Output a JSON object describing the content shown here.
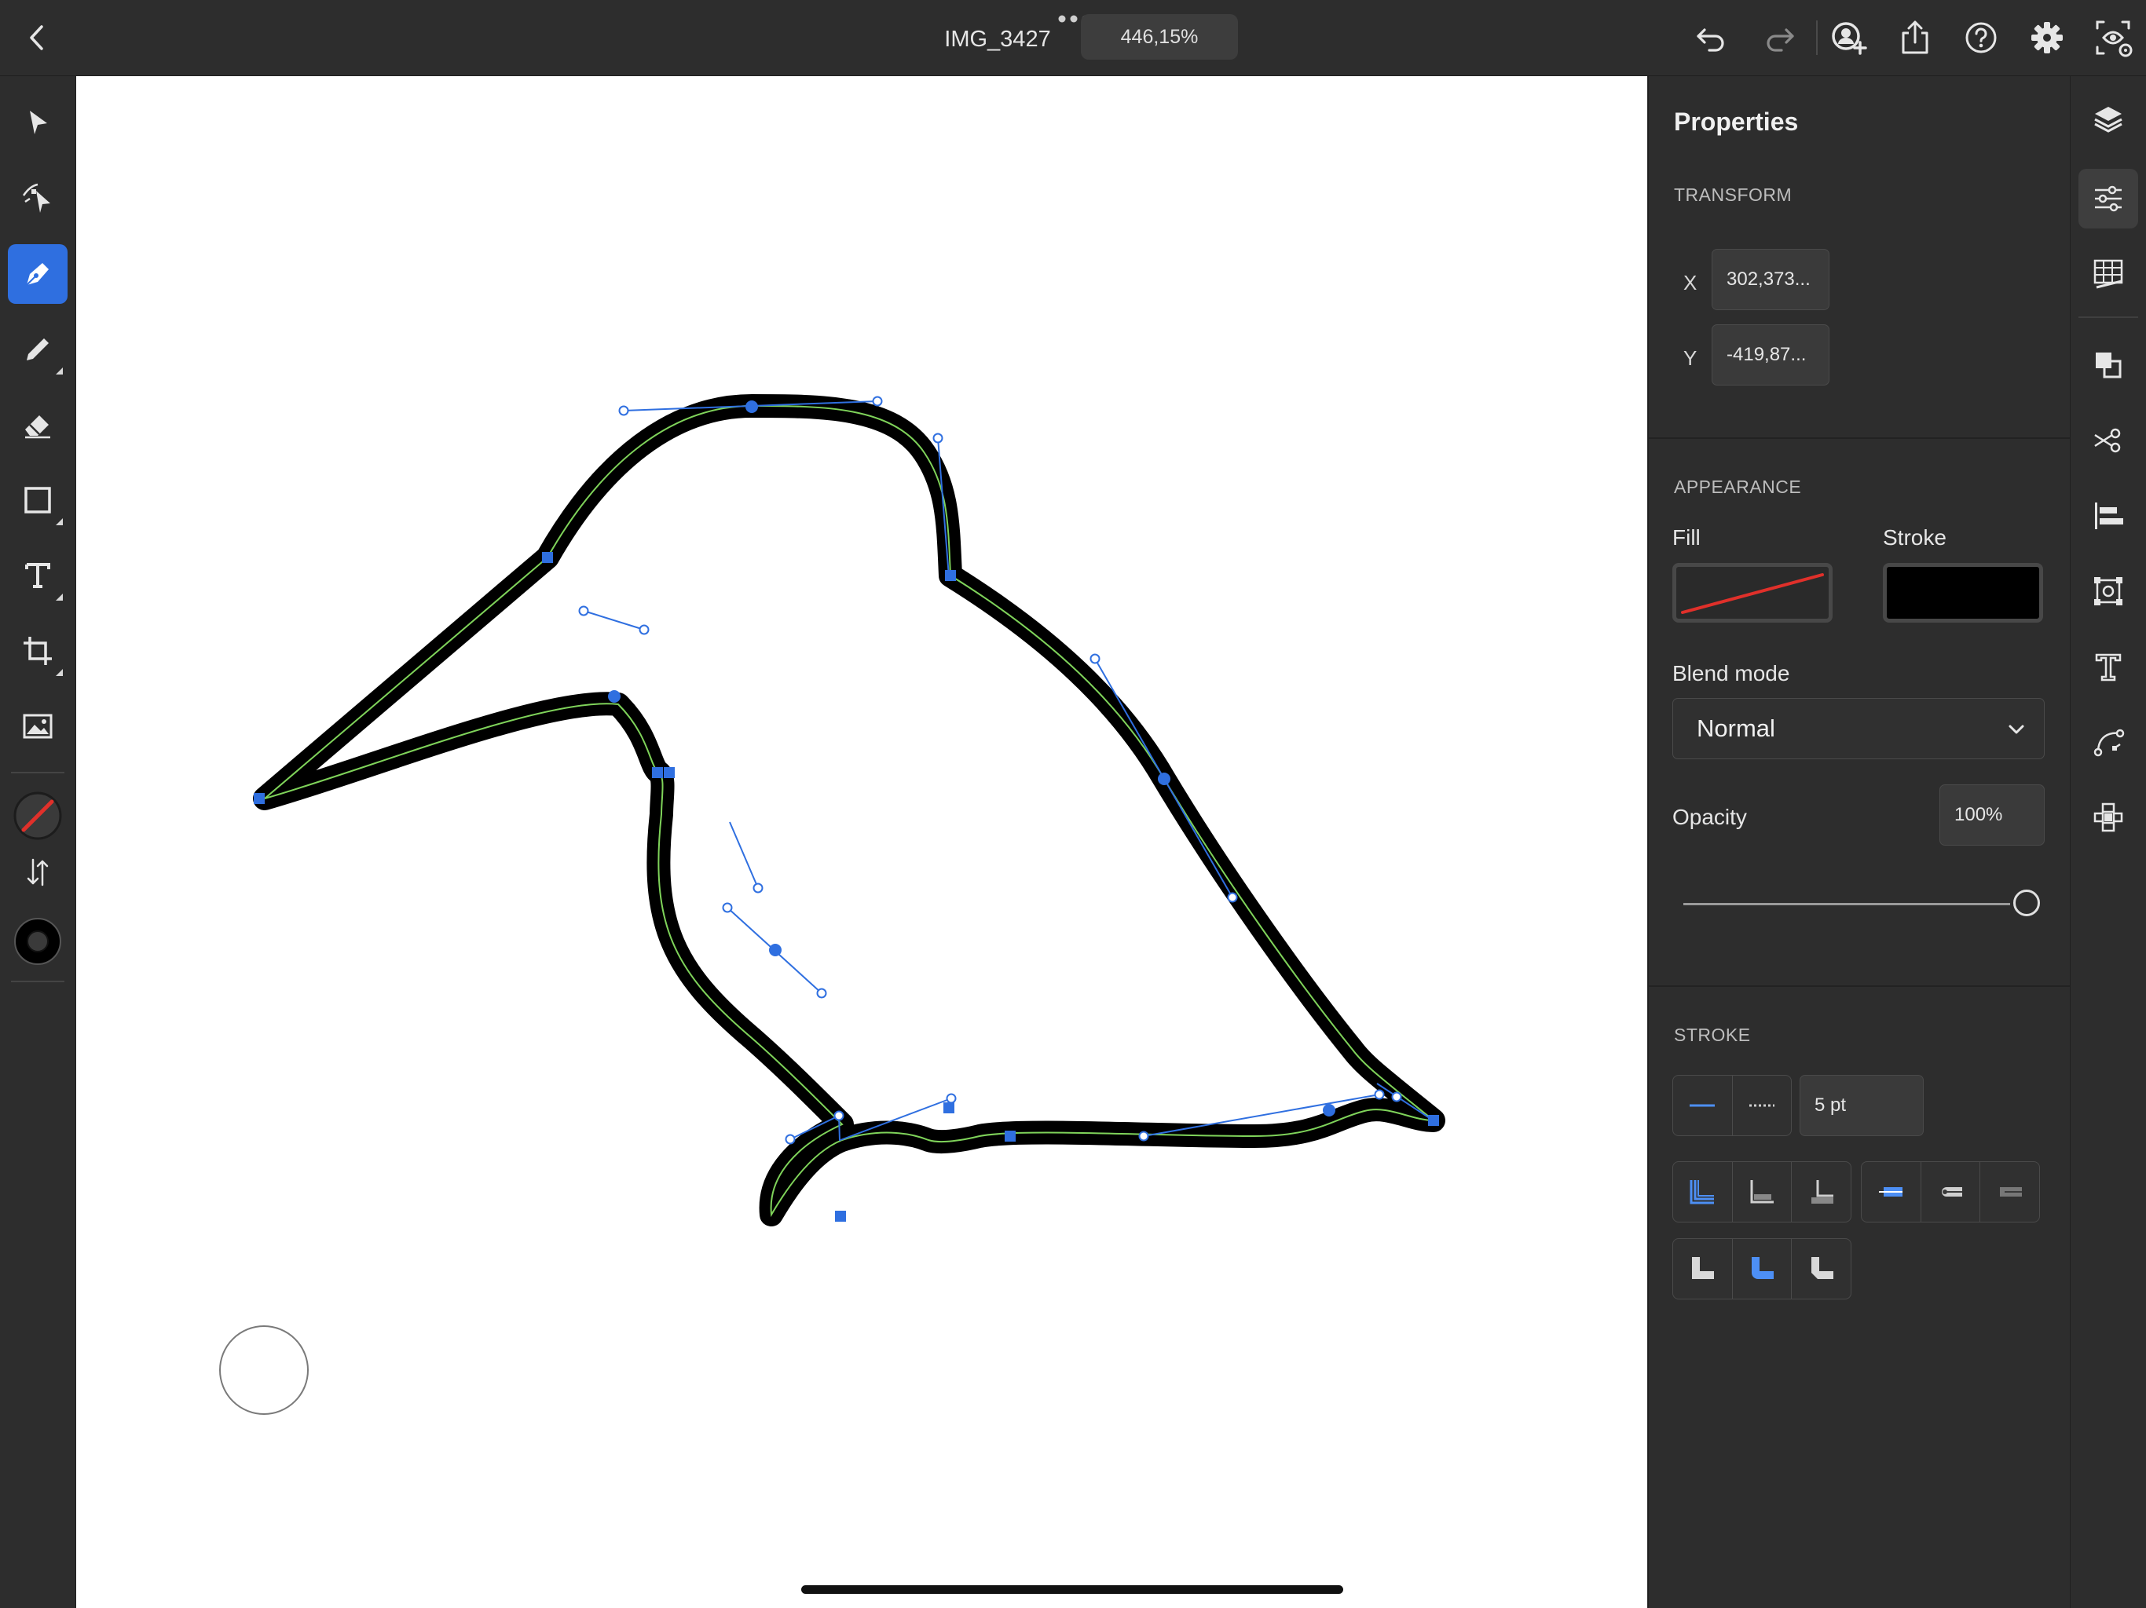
{
  "document": {
    "title": "IMG_3427",
    "zoom": "446,15%"
  },
  "toolbar": {
    "tools": [
      "selection-tool",
      "direct-selection-tool",
      "pen-tool",
      "pencil-tool",
      "eraser-tool",
      "shape-tool",
      "type-tool",
      "crop-tool",
      "place-image-tool"
    ],
    "active_tool": "pen-tool"
  },
  "properties": {
    "title": "Properties",
    "transform": {
      "label": "TRANSFORM",
      "x_label": "X",
      "x_value": "302,373...",
      "y_label": "Y",
      "y_value": "-419,87..."
    },
    "appearance": {
      "label": "APPEARANCE",
      "fill_label": "Fill",
      "fill_value": "none",
      "stroke_label": "Stroke",
      "stroke_color": "#000000",
      "blend_mode_label": "Blend mode",
      "blend_mode_value": "Normal",
      "opacity_label": "Opacity",
      "opacity_value": "100%",
      "opacity_fraction": 1.0
    },
    "stroke": {
      "label": "STROKE",
      "weight": "5 pt",
      "style_selected": "solid",
      "align_selected": "center",
      "cap_selected": "butt",
      "join_selected": "round"
    }
  },
  "colors": {
    "accent": "#2f6fe0",
    "fill_none_slash": "#e0302a",
    "stroke_swatch": "#000000",
    "path_guide": "#7fd35a",
    "anchor": "#2f6fe0"
  }
}
